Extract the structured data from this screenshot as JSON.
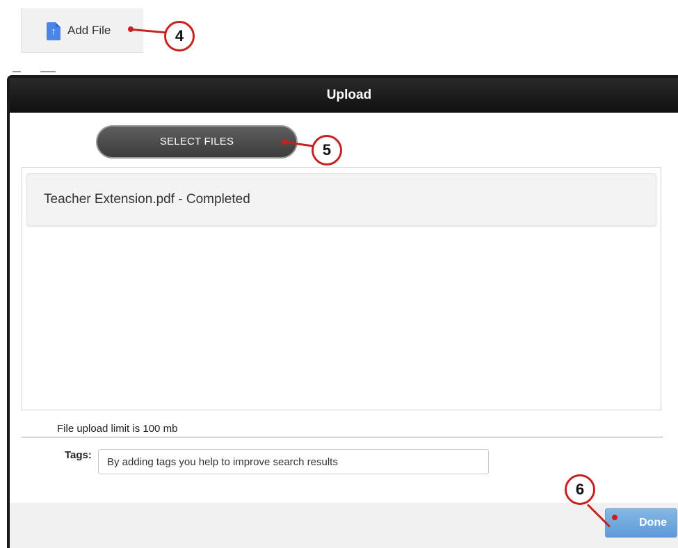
{
  "add_file": {
    "label": "Add File",
    "icon": "upload-document-icon"
  },
  "callouts": {
    "step4": "4",
    "step5": "5",
    "step6": "6",
    "color": "#c8201e"
  },
  "dialog": {
    "title": "Upload",
    "select_files_label": "SELECT FILES",
    "files": [
      {
        "text": "Teacher Extension.pdf - Completed"
      }
    ],
    "limit_text": "File upload limit is 100 mb",
    "tags_label": "Tags:",
    "tags_placeholder": "By adding tags you help to improve search results",
    "done_label": "Done"
  },
  "colors": {
    "titlebar": "#1a1a1a",
    "done_button": "#6fa8dc",
    "doc_icon": "#4a86e8"
  }
}
